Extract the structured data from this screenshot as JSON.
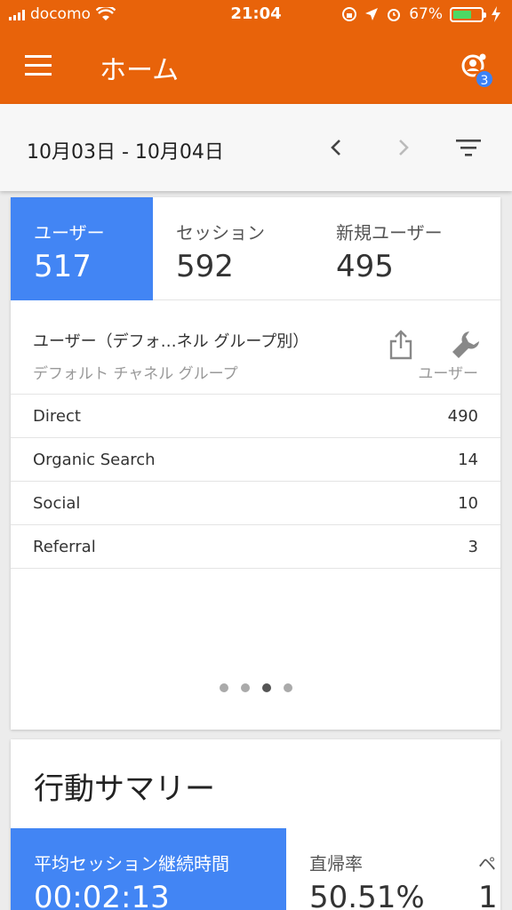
{
  "status_bar": {
    "carrier": "docomo",
    "time": "21:04",
    "battery": "67%",
    "battery_level": 0.67
  },
  "app_bar": {
    "title": "ホーム",
    "notification_count": "3",
    "accent": "#e8630a"
  },
  "date_bar": {
    "range": "10月03日 - 10月04日"
  },
  "metrics": [
    {
      "label": "ユーザー",
      "value": "517"
    },
    {
      "label": "セッション",
      "value": "592"
    },
    {
      "label": "新規ユーザー",
      "value": "495"
    }
  ],
  "table": {
    "title": "ユーザー（デフォ…ネル グループ別）",
    "dimension_header": "デフォルト チャネル グループ",
    "metric_header": "ユーザー",
    "rows": [
      {
        "name": "Direct",
        "value": "490"
      },
      {
        "name": "Organic Search",
        "value": "14"
      },
      {
        "name": "Social",
        "value": "10"
      },
      {
        "name": "Referral",
        "value": "3"
      }
    ]
  },
  "pager": {
    "count": 4,
    "active_index": 3
  },
  "summary": {
    "title": "行動サマリー",
    "metrics": [
      {
        "label": "平均セッション継続時間",
        "value": "00:02:13"
      },
      {
        "label": "直帰率",
        "value": "50.51%"
      },
      {
        "label": "ペ",
        "value": "1"
      }
    ]
  },
  "colors": {
    "active_tab": "#4285f4",
    "app_bar": "#e8630a",
    "badge": "#3b82f6"
  }
}
